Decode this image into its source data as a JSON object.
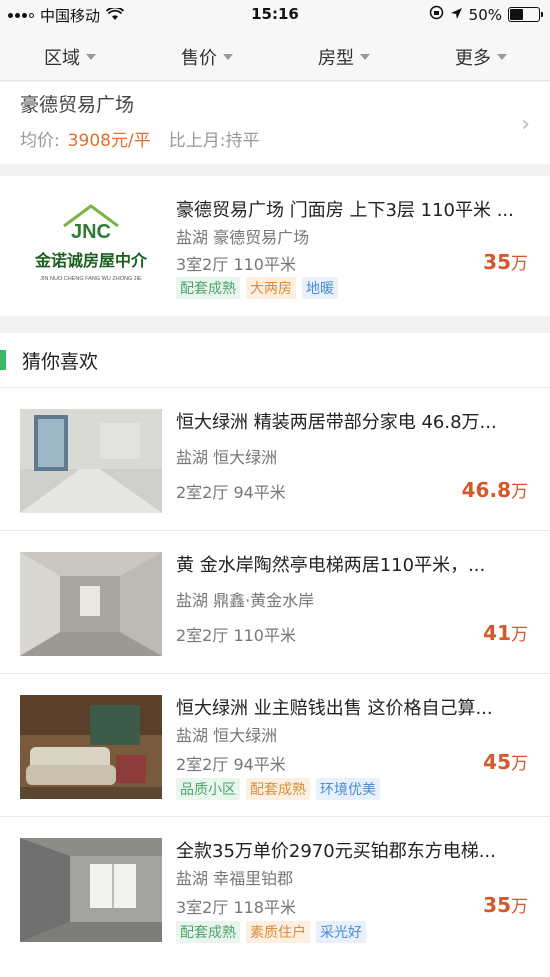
{
  "status": {
    "carrier": "中国移动",
    "time": "15:16",
    "battery": "50%",
    "battery_level": 0.5
  },
  "filters": [
    "区域",
    "售价",
    "房型",
    "更多"
  ],
  "estate": {
    "name": "豪德贸易广场",
    "avg_label": "均价:",
    "avg_price": "3908元/平",
    "compare": "比上月:持平"
  },
  "estate_listing": {
    "title": "豪德贸易广场 门面房 上下3层 110平米 ...",
    "location": "盐湖 豪德贸易广场",
    "spec": "3室2厅 110平米",
    "price": "35",
    "unit": "万",
    "tags": [
      "配套成熟",
      "大两房",
      "地暖"
    ],
    "logo_text": "金诺诚房屋中介",
    "logo_sub": "JIN NUO CHENG FANG WU ZHONG JIE",
    "logo_mark": "JNC"
  },
  "section_title": "猜你喜欢",
  "listings": [
    {
      "title": "恒大绿洲 精装两居带部分家电 46.8万...",
      "location": "盐湖 恒大绿洲",
      "spec": "2室2厅 94平米",
      "price": "46.8",
      "unit": "万",
      "tags": []
    },
    {
      "title": "黄 金水岸陶然亭电梯两居110平米，...",
      "location": "盐湖 鼎鑫·黄金水岸",
      "spec": "2室2厅 110平米",
      "price": "41",
      "unit": "万",
      "tags": []
    },
    {
      "title": "恒大绿洲 业主赔钱出售 这价格自己算...",
      "location": "盐湖 恒大绿洲",
      "spec": "2室2厅 94平米",
      "price": "45",
      "unit": "万",
      "tags": [
        "品质小区",
        "配套成熟",
        "环境优美"
      ]
    },
    {
      "title": "全款35万单价2970元买铂郡东方电梯...",
      "location": "盐湖 幸福里铂郡",
      "spec": "3室2厅 118平米",
      "price": "35",
      "unit": "万",
      "tags": [
        "配套成熟",
        "素质住户",
        "采光好"
      ]
    }
  ],
  "tag_colors": {
    "green": "#4ca36b",
    "orange": "#de8b37",
    "blue": "#4b8bd8"
  },
  "price_color": "#d4582b",
  "accent_color": "#39b86a"
}
